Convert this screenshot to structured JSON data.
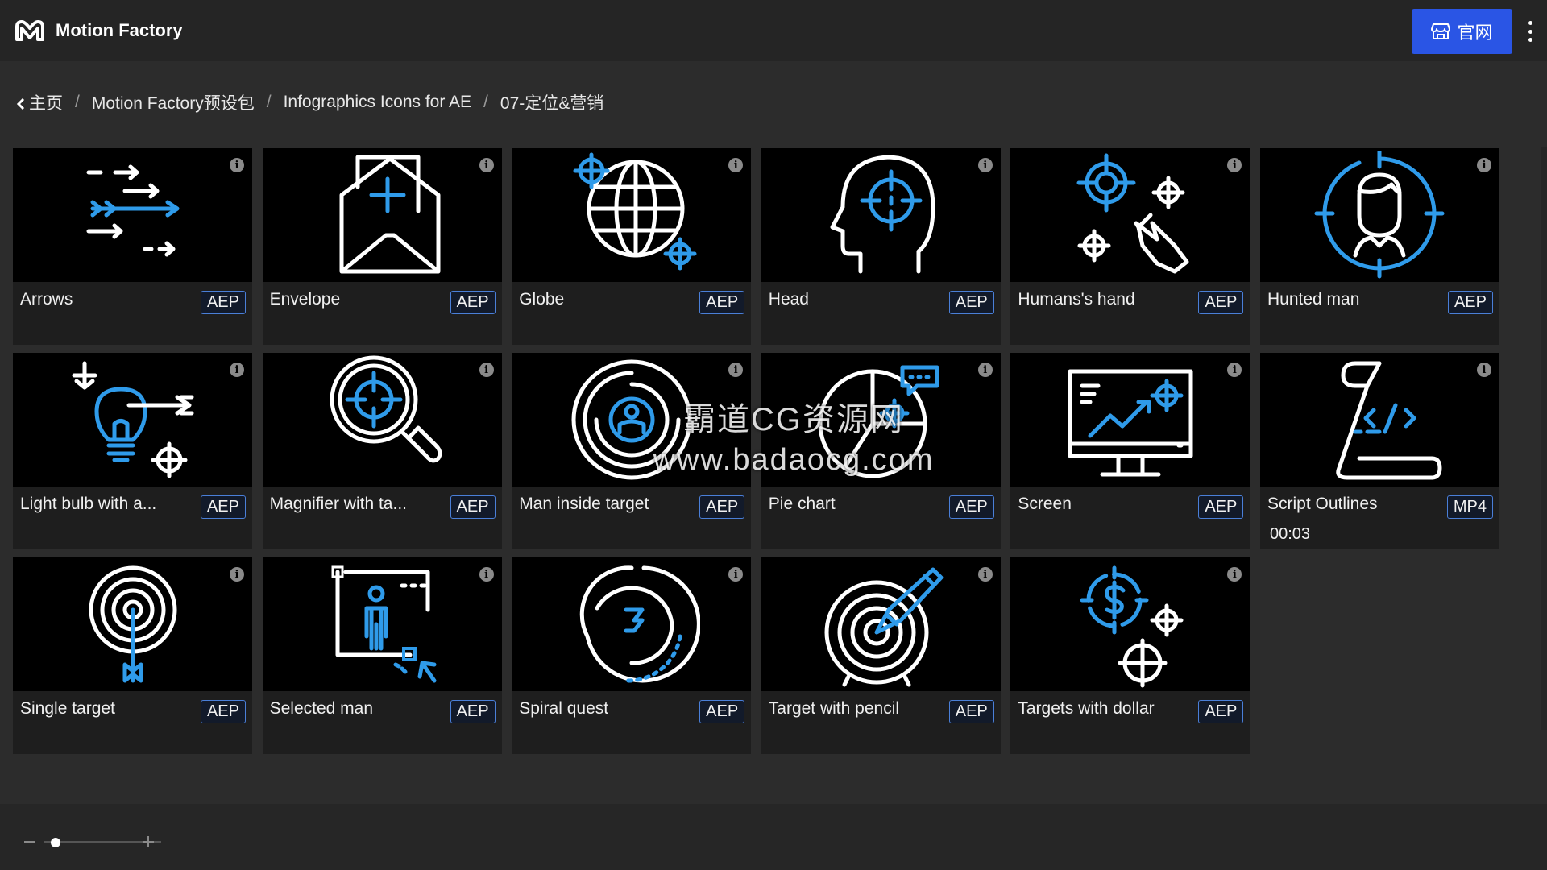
{
  "app": {
    "name": "Motion Factory",
    "official_label": "官网"
  },
  "breadcrumb": [
    {
      "label": "主页"
    },
    {
      "label": "Motion Factory预设包"
    },
    {
      "label": "Infographics Icons for AE"
    },
    {
      "label": "07-定位&营销"
    }
  ],
  "breadcrumb_sep": "/",
  "items": [
    {
      "title": "Arrows",
      "badge": "AEP",
      "icon": "arrows-icon"
    },
    {
      "title": "Envelope",
      "badge": "AEP",
      "icon": "envelope-icon"
    },
    {
      "title": "Globe",
      "badge": "AEP",
      "icon": "globe-icon"
    },
    {
      "title": "Head",
      "badge": "AEP",
      "icon": "head-icon"
    },
    {
      "title": "Humans's hand",
      "badge": "AEP",
      "icon": "hand-targets-icon"
    },
    {
      "title": "Hunted man",
      "badge": "AEP",
      "icon": "hunted-man-icon"
    },
    {
      "title": "Light bulb with a...",
      "badge": "AEP",
      "icon": "lightbulb-arrow-icon"
    },
    {
      "title": "Magnifier with ta...",
      "badge": "AEP",
      "icon": "magnifier-target-icon"
    },
    {
      "title": "Man inside target",
      "badge": "AEP",
      "icon": "man-target-icon"
    },
    {
      "title": "Pie chart",
      "badge": "AEP",
      "icon": "pie-chart-icon"
    },
    {
      "title": "Screen",
      "badge": "AEP",
      "icon": "screen-chart-icon"
    },
    {
      "title": "Script Outlines",
      "badge": "MP4",
      "icon": "script-icon",
      "duration": "00:03"
    },
    {
      "title": "Single target",
      "badge": "AEP",
      "icon": "single-target-icon"
    },
    {
      "title": "Selected man",
      "badge": "AEP",
      "icon": "selected-man-icon"
    },
    {
      "title": "Spiral quest",
      "badge": "AEP",
      "icon": "spiral-icon"
    },
    {
      "title": "Target with pencil",
      "badge": "AEP",
      "icon": "target-pencil-icon"
    },
    {
      "title": "Targets with dollar",
      "badge": "AEP",
      "icon": "targets-dollar-icon"
    }
  ],
  "info_glyph": "i",
  "watermark": {
    "line1": "霸道CG资源网",
    "line2": "www.badaocg.com"
  },
  "zoom": {
    "level": 0.05
  },
  "colors": {
    "accent": "#2a55e5",
    "icon_blue": "#2f9bea",
    "badge_border": "#4a7fd8"
  }
}
